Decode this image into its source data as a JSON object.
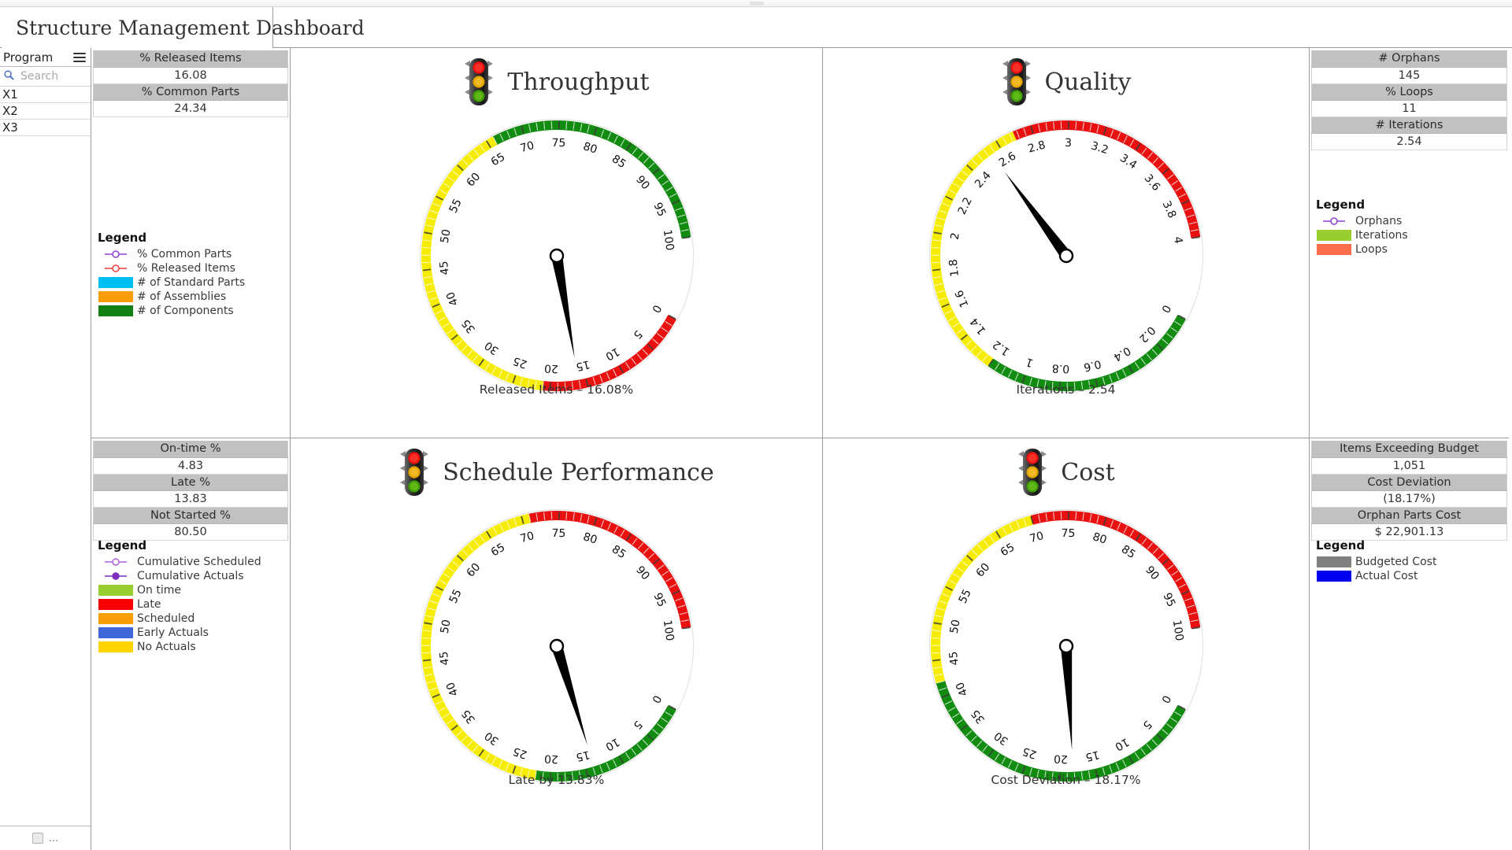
{
  "window": {
    "tab_title": "Structure Management Dashboard"
  },
  "sidebar": {
    "header_label": "Program",
    "menu_icon": "hamburger-icon",
    "search_placeholder": "Search",
    "search_value": "",
    "items": [
      {
        "label": "X1"
      },
      {
        "label": "X2"
      },
      {
        "label": "X3"
      }
    ],
    "footer_ellipsis": "..."
  },
  "panels": {
    "throughput_kpis": {
      "rows": [
        {
          "header": "% Released Items",
          "value": "16.08"
        },
        {
          "header": "% Common Parts",
          "value": "24.34"
        }
      ],
      "legend": {
        "title": "Legend",
        "entries": [
          {
            "label": "% Common Parts",
            "marker": "open-circle",
            "color": "#8e3fd4"
          },
          {
            "label": "% Released Items",
            "marker": "open-circle",
            "color": "#ef3b3b"
          },
          {
            "label": "# of Standard Parts",
            "marker": "swatch",
            "color": "#00bff3"
          },
          {
            "label": "# of Assemblies",
            "marker": "swatch",
            "color": "#f99d0b"
          },
          {
            "label": "# of Components",
            "marker": "swatch",
            "color": "#128012"
          }
        ]
      }
    },
    "quality_kpis": {
      "rows": [
        {
          "header": "# Orphans",
          "value": "145"
        },
        {
          "header": "% Loops",
          "value": "11"
        },
        {
          "header": "# Iterations",
          "value": "2.54"
        }
      ],
      "legend": {
        "title": "Legend",
        "entries": [
          {
            "label": "Orphans",
            "marker": "open-circle",
            "color": "#8e3fd4"
          },
          {
            "label": "Iterations",
            "marker": "swatch",
            "color": "#9acd32"
          },
          {
            "label": "Loops",
            "marker": "swatch",
            "color": "#fb6d4c"
          }
        ]
      }
    },
    "schedule_kpis": {
      "rows": [
        {
          "header": "On-time %",
          "value": "4.83"
        },
        {
          "header": "Late %",
          "value": "13.83"
        },
        {
          "header": "Not Started %",
          "value": "80.50"
        }
      ],
      "legend": {
        "title": "Legend",
        "entries": [
          {
            "label": "Cumulative Scheduled",
            "marker": "open-circle",
            "color": "#b060e0"
          },
          {
            "label": "Cumulative Actuals",
            "marker": "filled-circle",
            "color": "#7b2fbf"
          },
          {
            "label": "On time",
            "marker": "swatch",
            "color": "#9acd32"
          },
          {
            "label": "Late",
            "marker": "swatch",
            "color": "#fb0000"
          },
          {
            "label": "Scheduled",
            "marker": "swatch",
            "color": "#f99d0b"
          },
          {
            "label": "Early Actuals",
            "marker": "swatch",
            "color": "#3f66d6"
          },
          {
            "label": "No Actuals",
            "marker": "swatch",
            "color": "#ffd400"
          }
        ]
      }
    },
    "cost_kpis": {
      "rows": [
        {
          "header": "Items Exceeding Budget",
          "value": "1,051"
        },
        {
          "header": "Cost Deviation",
          "value": "(18.17%)"
        },
        {
          "header": "Orphan Parts Cost",
          "value": "$ 22,901.13"
        }
      ],
      "legend": {
        "title": "Legend",
        "entries": [
          {
            "label": "Budgeted Cost",
            "marker": "swatch",
            "color": "#808080"
          },
          {
            "label": "Actual Cost",
            "marker": "swatch",
            "color": "#0000ee"
          }
        ]
      }
    }
  },
  "gauges": [
    {
      "id": "throughput",
      "title": "Throughput",
      "icon": "traffic-light-icon",
      "caption": "Released Items – 16.08%",
      "value": 16.08,
      "min": 0,
      "max": 100,
      "tick_step": 5,
      "bands": [
        {
          "from": 0,
          "to": 21,
          "color": "#e8110f"
        },
        {
          "from": 21,
          "to": 66,
          "color": "#f5ec00"
        },
        {
          "from": 66,
          "to": 100,
          "color": "#118c11"
        }
      ],
      "tick_labels": [
        "0",
        "5",
        "10",
        "15",
        "20",
        "25",
        "30",
        "35",
        "40",
        "45",
        "50",
        "55",
        "60",
        "65",
        "70",
        "75",
        "80",
        "85",
        "90",
        "95",
        "100"
      ]
    },
    {
      "id": "quality",
      "title": "Quality",
      "icon": "traffic-light-icon",
      "caption": "Iterations – 2.54",
      "value": 2.54,
      "min": 0,
      "max": 4,
      "tick_step": 0.2,
      "bands": [
        {
          "from": 0,
          "to": 1.2,
          "color": "#118c11"
        },
        {
          "from": 1.2,
          "to": 2.7,
          "color": "#f5ec00"
        },
        {
          "from": 2.7,
          "to": 4,
          "color": "#e8110f"
        }
      ],
      "tick_labels": [
        "0",
        "0.2",
        "0.4",
        "0.6",
        "0.8",
        "1",
        "1.2",
        "1.4",
        "1.6",
        "1.8",
        "2",
        "2.2",
        "2.4",
        "2.6",
        "2.8",
        "3",
        "3.2",
        "3.4",
        "3.6",
        "3.8",
        "4"
      ]
    },
    {
      "id": "schedule",
      "title": "Schedule Performance",
      "icon": "traffic-light-icon",
      "caption": "Late by 13.83%",
      "value": 13.83,
      "min": 0,
      "max": 100,
      "tick_step": 5,
      "bands": [
        {
          "from": 0,
          "to": 22,
          "color": "#118c11"
        },
        {
          "from": 22,
          "to": 71,
          "color": "#f5ec00"
        },
        {
          "from": 71,
          "to": 100,
          "color": "#e8110f"
        }
      ],
      "tick_labels": [
        "0",
        "5",
        "10",
        "15",
        "20",
        "25",
        "30",
        "35",
        "40",
        "45",
        "50",
        "55",
        "60",
        "65",
        "70",
        "75",
        "80",
        "85",
        "90",
        "95",
        "100"
      ]
    },
    {
      "id": "cost",
      "title": "Cost",
      "icon": "traffic-light-icon",
      "caption": "Cost Deviation – 18.17%",
      "value": 18.17,
      "min": 0,
      "max": 100,
      "tick_step": 5,
      "bands": [
        {
          "from": 0,
          "to": 42,
          "color": "#118c11"
        },
        {
          "from": 42,
          "to": 70,
          "color": "#f5ec00"
        },
        {
          "from": 70,
          "to": 100,
          "color": "#e8110f"
        }
      ],
      "tick_labels": [
        "0",
        "5",
        "10",
        "15",
        "20",
        "25",
        "30",
        "35",
        "40",
        "45",
        "50",
        "55",
        "60",
        "65",
        "70",
        "75",
        "80",
        "85",
        "90",
        "95",
        "100"
      ]
    }
  ],
  "chart_data": {
    "type": "gauge-dashboard",
    "title": "Structure Management Dashboard",
    "gauges": [
      {
        "name": "Throughput",
        "metric": "Released Items",
        "value": 16.08,
        "unit": "%",
        "min": 0,
        "max": 100,
        "bands": [
          [
            "red",
            0,
            21
          ],
          [
            "yellow",
            21,
            66
          ],
          [
            "green",
            66,
            100
          ]
        ]
      },
      {
        "name": "Quality",
        "metric": "Iterations",
        "value": 2.54,
        "unit": "",
        "min": 0,
        "max": 4,
        "bands": [
          [
            "green",
            0,
            1.2
          ],
          [
            "yellow",
            1.2,
            2.7
          ],
          [
            "red",
            2.7,
            4
          ]
        ]
      },
      {
        "name": "Schedule Performance",
        "metric": "Late by",
        "value": 13.83,
        "unit": "%",
        "min": 0,
        "max": 100,
        "bands": [
          [
            "green",
            0,
            22
          ],
          [
            "yellow",
            22,
            71
          ],
          [
            "red",
            71,
            100
          ]
        ]
      },
      {
        "name": "Cost",
        "metric": "Cost Deviation",
        "value": 18.17,
        "unit": "%",
        "min": 0,
        "max": 100,
        "bands": [
          [
            "green",
            0,
            42
          ],
          [
            "yellow",
            42,
            70
          ],
          [
            "red",
            70,
            100
          ]
        ]
      }
    ],
    "kpis": [
      {
        "label": "% Released Items",
        "value": 16.08
      },
      {
        "label": "% Common Parts",
        "value": 24.34
      },
      {
        "label": "# Orphans",
        "value": 145
      },
      {
        "label": "% Loops",
        "value": 11
      },
      {
        "label": "# Iterations",
        "value": 2.54
      },
      {
        "label": "On-time %",
        "value": 4.83
      },
      {
        "label": "Late %",
        "value": 13.83
      },
      {
        "label": "Not Started %",
        "value": 80.5
      },
      {
        "label": "Items Exceeding Budget",
        "value": 1051
      },
      {
        "label": "Cost Deviation",
        "value": -18.17
      },
      {
        "label": "Orphan Parts Cost",
        "value": 22901.13
      }
    ]
  }
}
